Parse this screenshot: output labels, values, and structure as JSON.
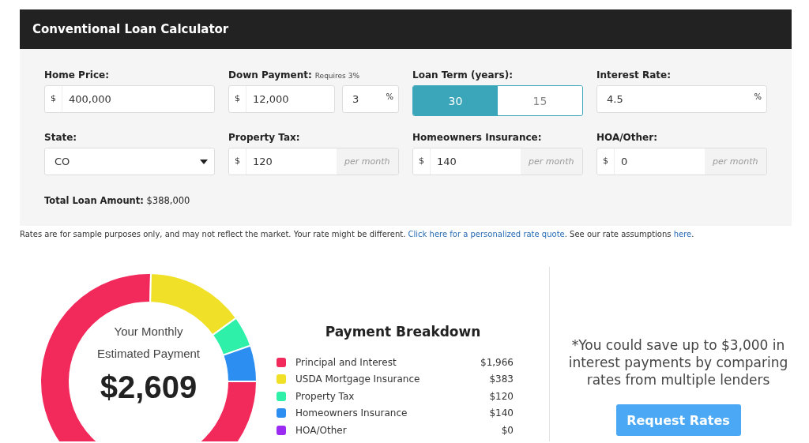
{
  "title": "Conventional Loan Calculator",
  "fields": [
    {
      "label": "Home Price:",
      "kind": "prefixed",
      "prefix": "$",
      "value": "400,000"
    },
    {
      "label": "Down Payment:",
      "note": "Requires 3%",
      "kind": "split",
      "prefix": "$",
      "value": "12,000",
      "second_value": "3",
      "second_suffix": "%"
    },
    {
      "label": "Loan Term (years):",
      "kind": "toggle",
      "options": [
        {
          "label": "30",
          "selected": true
        },
        {
          "label": "15",
          "selected": false
        }
      ]
    },
    {
      "label": "Interest Rate:",
      "kind": "suffixed",
      "value": "4.5",
      "suffix": "%"
    },
    {
      "label": "State:",
      "kind": "select",
      "value": "CO"
    },
    {
      "label": "Property Tax:",
      "kind": "prefixed",
      "prefix": "$",
      "value": "120",
      "unit": "per month"
    },
    {
      "label": "Homeowners Insurance:",
      "kind": "prefixed",
      "prefix": "$",
      "value": "140",
      "unit": "per month"
    },
    {
      "label": "HOA/Other:",
      "kind": "prefixed",
      "prefix": "$",
      "value": "0",
      "unit": "per month"
    }
  ],
  "total_loan": "**Total Loan Amount:** $388,000",
  "disclaimer": [
    {
      "kind": "text",
      "text": "Rates are for sample purposes only, and may not reflect the market. Your rate might be different. "
    },
    {
      "kind": "link",
      "text": "Click here for a personalized rate quote"
    },
    {
      "kind": "text",
      "text": ". See our rate assumptions "
    },
    {
      "kind": "link",
      "text": "here"
    },
    {
      "kind": "text",
      "text": "."
    }
  ],
  "summary": {
    "line_1": "Your Monthly",
    "line_2": "Estimated Payment",
    "amount": "$2,609"
  },
  "chart_data": {
    "type": "donut",
    "categories": [
      "Principal and Interest",
      "USDA Mortgage Insurance",
      "Property Tax",
      "Homeowners Insurance",
      "HOA/Other"
    ],
    "series": [
      {
        "values": [
          75.35,
          14.68,
          4.6,
          5.37,
          0
        ]
      }
    ]
  },
  "breakdown": {
    "title": "Payment Breakdown",
    "items": [
      {
        "amount": "$1,966",
        "color": "#f2295b"
      },
      {
        "amount": "$383",
        "color": "#f0e028"
      },
      {
        "amount": "$120",
        "color": "#2ef0a8"
      },
      {
        "amount": "$140",
        "color": "#2b8ef0"
      },
      {
        "amount": "$0",
        "color": "#9b2bf0"
      }
    ]
  },
  "promo": {
    "text": "*You could save up to $3,000 in interest payments by comparing rates from multiple lenders",
    "button": "Request Rates"
  }
}
